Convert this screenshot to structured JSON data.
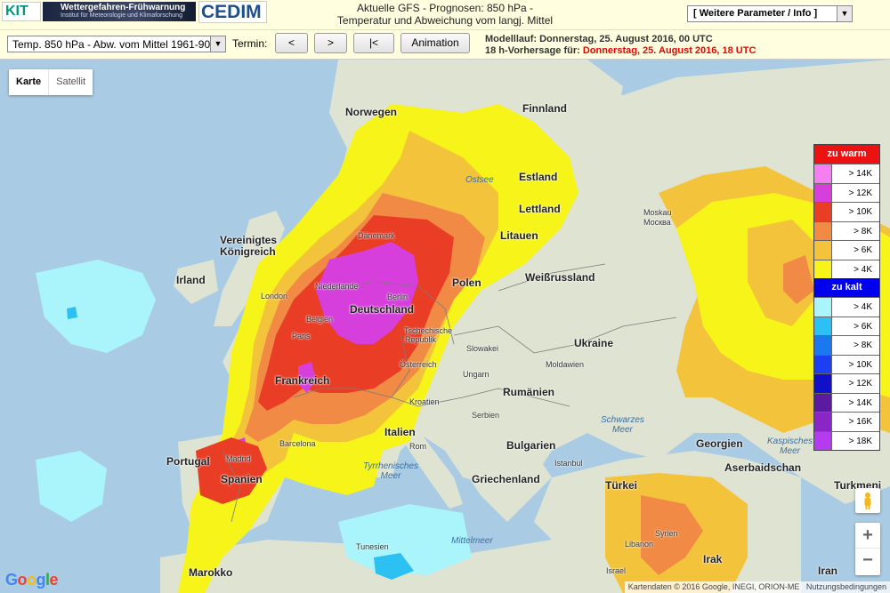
{
  "header": {
    "logo_kit": "KIT",
    "logo_wf_title": "Wettergefahren-Frühwarnung",
    "logo_wf_subtitle": "Institut für Meteorologie und Klimaforschung",
    "logo_cedim": "CEDIM",
    "title_line1": "Aktuelle GFS - Prognosen: 850 hPa -",
    "title_line2": "Temperatur und Abweichung vom langj. Mittel",
    "param_select": "[ Weitere Parameter / Info ]"
  },
  "toolbar": {
    "variable_select": "Temp. 850 hPa - Abw. vom Mittel 1961-90",
    "termin_label": "Termin:",
    "prev_label": "<",
    "next_label": ">",
    "first_label": "|<",
    "animation_label": "Animation",
    "run_label": "Modelllauf: Donnerstag, 25. August 2016, 00 UTC",
    "forecast_prefix": "18 h-Vorhersage für: ",
    "forecast_value": "Donnerstag, 25. August 2016, 18 UTC"
  },
  "map": {
    "maptype_karte": "Karte",
    "maptype_satellit": "Satellit",
    "zoom_in": "+",
    "zoom_out": "−",
    "attribution_data": "Kartendaten © 2016 Google, INEGI, ORION-ME",
    "attribution_terms": "Nutzungsbedingungen",
    "google_logo": "Google",
    "labels": {
      "finnland": "Finnland",
      "norwegen": "Norwegen",
      "estland": "Estland",
      "lettland": "Lettland",
      "litauen": "Litauen",
      "moskau": "Moskau",
      "moskva": "Москва",
      "uk1": "Vereinigtes",
      "uk2": "Königreich",
      "irland": "Irland",
      "daenemark": "Dänemark",
      "niederlande": "Niederlande",
      "berlin": "Berlin",
      "polen": "Polen",
      "weissrussland": "Weißrussland",
      "london": "London",
      "belgien": "Belgien",
      "deutschland": "Deutschland",
      "paris": "Paris",
      "tschechien1": "Tschechische",
      "tschechien2": "Republik",
      "slowakei": "Slowakei",
      "ukraine": "Ukraine",
      "moldawien": "Moldawien",
      "frankreich": "Frankreich",
      "oesterreich": "Österreich",
      "ungarn": "Ungarn",
      "rumaenien": "Rumänien",
      "kroatien": "Kroatien",
      "serbien": "Serbien",
      "schwarzes1": "Schwarzes",
      "schwarzes2": "Meer",
      "italien": "Italien",
      "barcelona": "Barcelona",
      "rom": "Rom",
      "bulgarien": "Bulgarien",
      "georgien": "Georgien",
      "kaspisches1": "Kaspisches",
      "kaspisches2": "Meer",
      "portugal": "Portugal",
      "madrid": "Madrid",
      "spanien": "Spanien",
      "tyrrhenisches1": "Tyrrhenisches",
      "tyrrhenisches2": "Meer",
      "istanbul": "Istanbul",
      "griechenland": "Griechenland",
      "aserbaidschan": "Aserbaidschan",
      "tuerkei": "Türkei",
      "turkmenien": "Turkmeni",
      "mittelmeer": "Mittelmeer",
      "tunesien": "Tunesien",
      "marokko": "Marokko",
      "libanon": "Libanon",
      "syrien": "Syrien",
      "irak": "Irak",
      "iran": "Iran",
      "israel": "Israel",
      "ostsee": "Ostsee"
    }
  },
  "legend": {
    "warm_title": "zu warm",
    "cold_title": "zu kalt",
    "warm_color": "#ee1111",
    "cold_color": "#0000ee",
    "warm": [
      {
        "label": "> 14K",
        "color": "#f47ff0"
      },
      {
        "label": "> 12K",
        "color": "#d63fdc"
      },
      {
        "label": "> 10K",
        "color": "#ea3d25"
      },
      {
        "label": "> 8K",
        "color": "#f08a45"
      },
      {
        "label": "> 6K",
        "color": "#f4c33c"
      },
      {
        "label": "> 4K",
        "color": "#f6f419"
      }
    ],
    "cold": [
      {
        "label": "> 4K",
        "color": "#a9f5fb"
      },
      {
        "label": "> 6K",
        "color": "#2cc0f3"
      },
      {
        "label": "> 8K",
        "color": "#1a79ef"
      },
      {
        "label": "> 10K",
        "color": "#1d3ff2"
      },
      {
        "label": "> 12K",
        "color": "#1010c8"
      },
      {
        "label": "> 14K",
        "color": "#5c1aa0"
      },
      {
        "label": "> 16K",
        "color": "#8a25c8"
      },
      {
        "label": "> 18K",
        "color": "#b53bf0"
      }
    ]
  }
}
